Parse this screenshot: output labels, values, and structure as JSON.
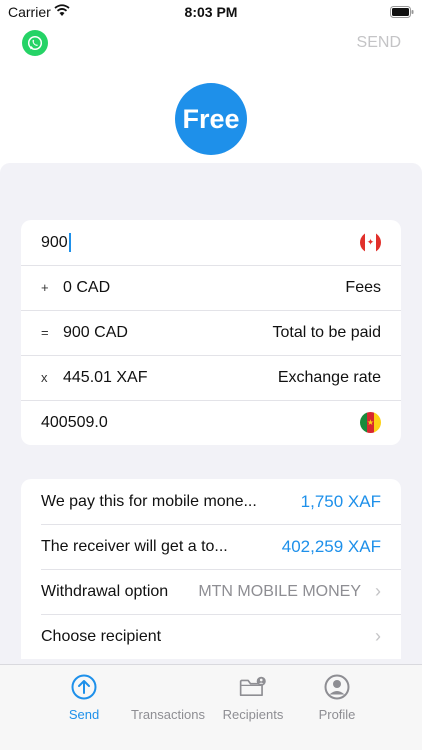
{
  "status_bar": {
    "carrier": "Carrier",
    "time": "8:03 PM"
  },
  "top_bar": {
    "send_label": "SEND"
  },
  "badge": {
    "label": "Free"
  },
  "calculator": {
    "amount_value": "900",
    "fees": {
      "sign": "+",
      "value": "0 CAD",
      "label": "Fees"
    },
    "total": {
      "sign": "=",
      "value": "900 CAD",
      "label": "Total to be paid"
    },
    "rate": {
      "sign": "x",
      "value": "445.01 XAF",
      "label": "Exchange rate"
    },
    "received_value": "400509.0"
  },
  "info": {
    "mobile_money": {
      "label": "We pay this for mobile mone...",
      "value": "1,750 XAF"
    },
    "receiver": {
      "label": "The receiver will get a to...",
      "value": "402,259 XAF"
    },
    "withdrawal": {
      "label": "Withdrawal option",
      "value": "MTN MOBILE MONEY"
    },
    "recipient": {
      "label": "Choose recipient"
    }
  },
  "tabs": [
    {
      "label": "Send",
      "icon": "send-icon",
      "active": true
    },
    {
      "label": "Transactions",
      "icon": "transactions-icon",
      "active": false
    },
    {
      "label": "Recipients",
      "icon": "recipients-icon",
      "active": false
    },
    {
      "label": "Profile",
      "icon": "profile-icon",
      "active": false
    }
  ],
  "colors": {
    "accent": "#1e90ea",
    "sheet": "#f2f2f7",
    "whatsapp": "#25d366"
  }
}
